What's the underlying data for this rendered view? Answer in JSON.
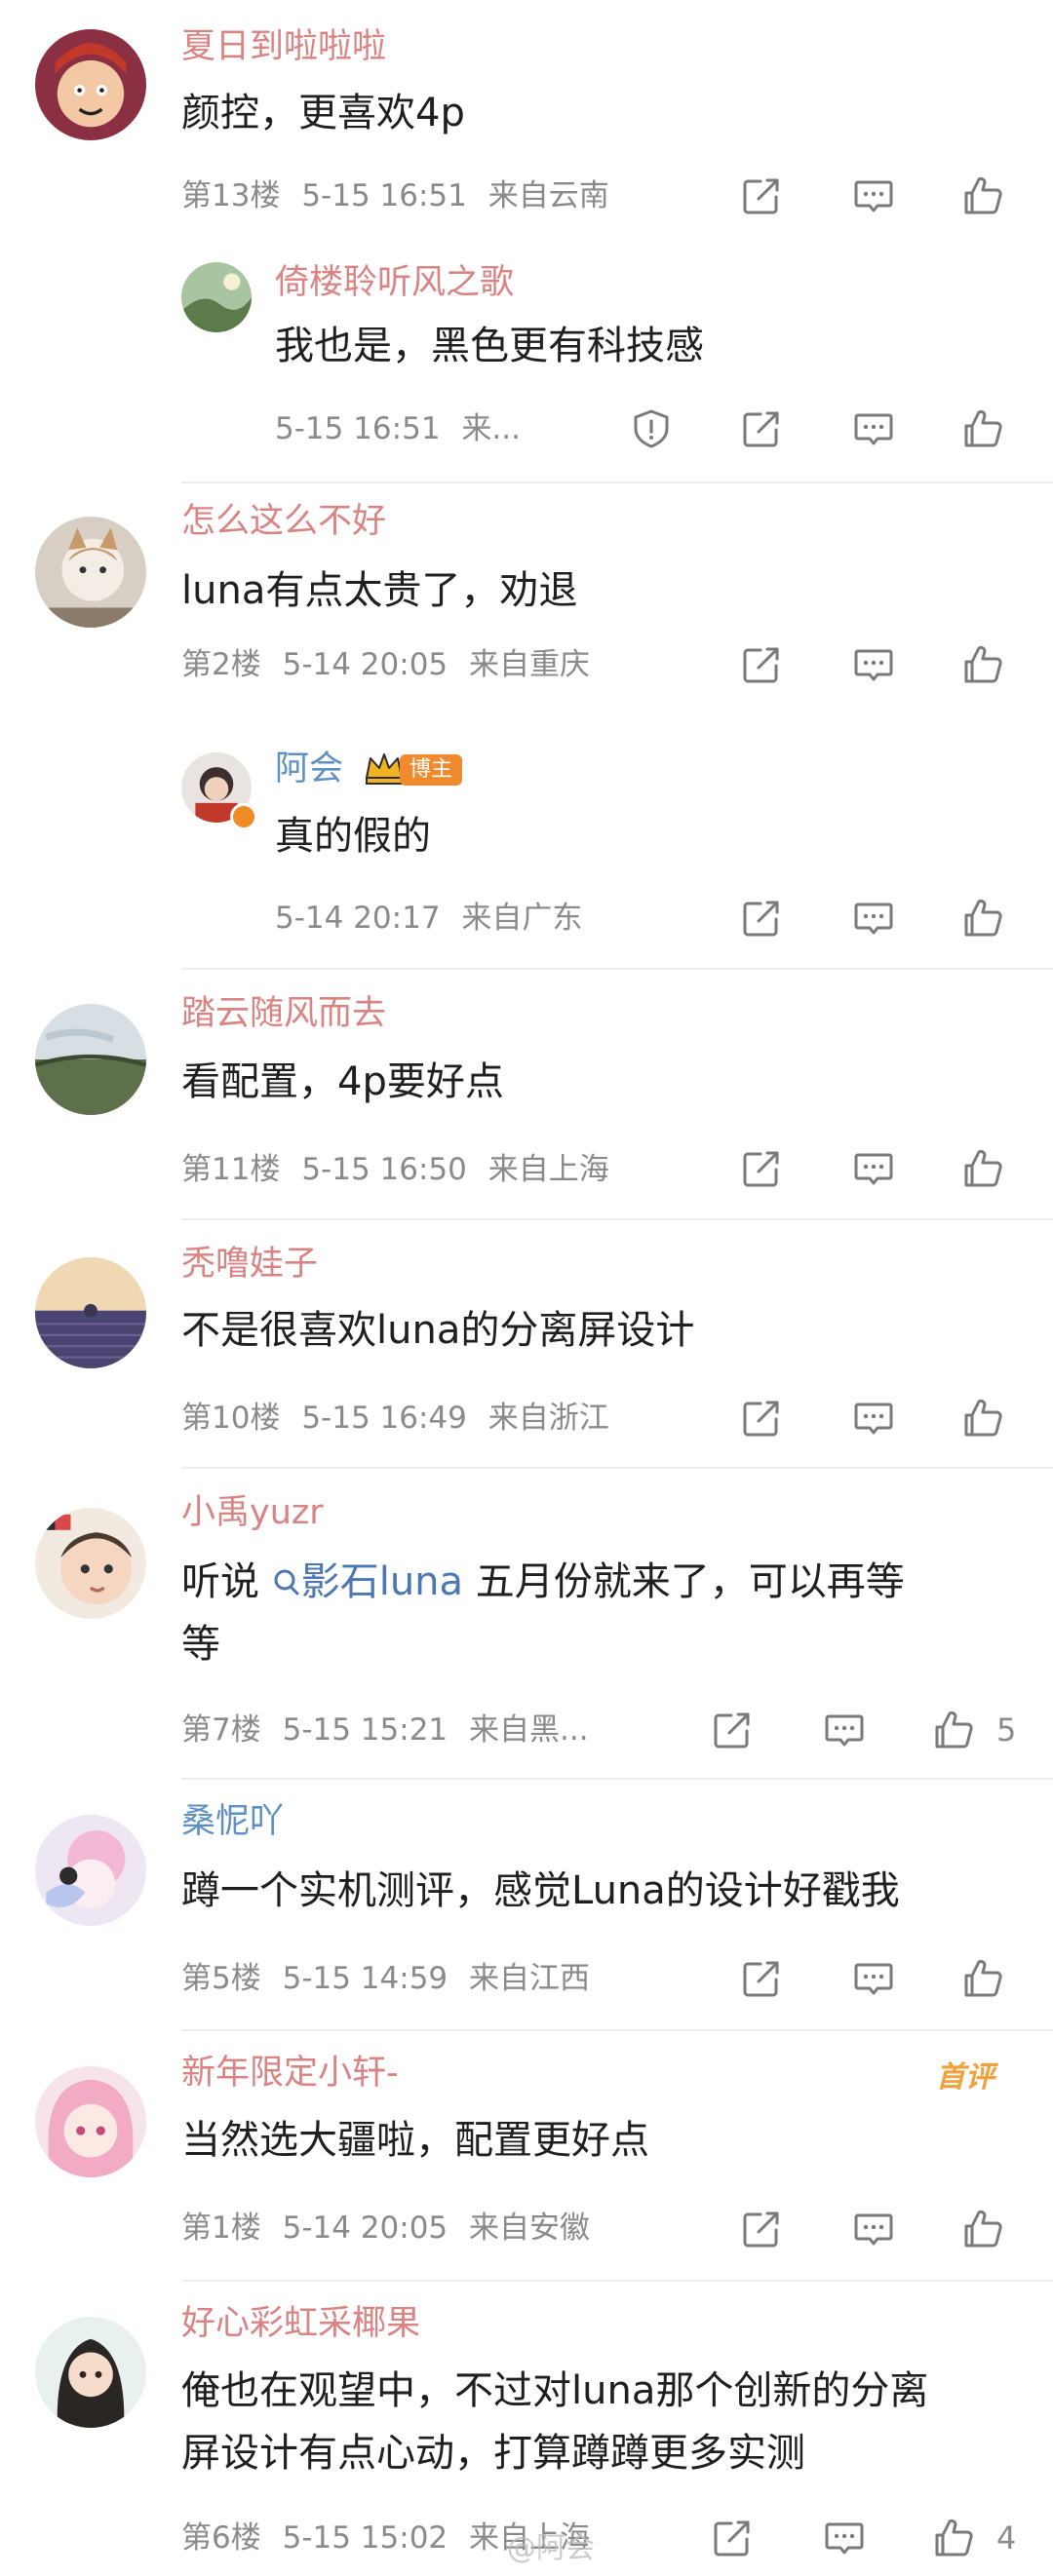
{
  "comments": [
    {
      "user": "夏日到啦啦啦",
      "text": "颜控，更喜欢4p",
      "floor": "第13楼",
      "time": "5-15 16:51",
      "location": "来自云南"
    },
    {
      "user": "倚楼聆听风之歌",
      "text": "我也是，黑色更有科技感",
      "time": "5-15 16:51",
      "location": "来..."
    },
    {
      "user": "怎么这么不好",
      "text": "luna有点太贵了，劝退",
      "floor": "第2楼",
      "time": "5-14 20:05",
      "location": "来自重庆"
    },
    {
      "user": "阿会",
      "badge": "博主",
      "text": "真的假的",
      "time": "5-14 20:17",
      "location": "来自广东"
    },
    {
      "user": "踏云随风而去",
      "text": "看配置，4p要好点",
      "floor": "第11楼",
      "time": "5-15 16:50",
      "location": "来自上海"
    },
    {
      "user": "秃噜娃子",
      "text": "不是很喜欢luna的分离屏设计",
      "floor": "第10楼",
      "time": "5-15 16:49",
      "location": "来自浙江"
    },
    {
      "user": "小禹yuzr",
      "text_before": "听说",
      "topic": "影石luna",
      "text_after": " 五月份就来了，可以再等",
      "text_line2": "等",
      "floor": "第7楼",
      "time": "5-15 15:21",
      "location": "来自黑...",
      "likes": "5"
    },
    {
      "user": "桑怩吖",
      "text": "蹲一个实机测评，感觉Luna的设计好戳我",
      "floor": "第5楼",
      "time": "5-15 14:59",
      "location": "来自江西"
    },
    {
      "user": "新年限定小轩-",
      "tag": "首评",
      "text": "当然选大疆啦，配置更好点",
      "floor": "第1楼",
      "time": "5-14 20:05",
      "location": "来自安徽"
    },
    {
      "user": "好心彩虹采椰果",
      "text_line1": "俺也在观望中，不过对luna那个创新的分离",
      "text_line2": "屏设计有点心动，打算蹲蹲更多实测",
      "floor": "第6楼",
      "time": "5-15 15:02",
      "location": "来自上海",
      "likes": "4"
    }
  ],
  "watermark": "@阿会",
  "colors": {
    "username": "#d98383",
    "username_blogger": "#5e8fc3",
    "meta": "#8a8a8a",
    "badge": "#ef8a2f",
    "topic_link": "#4b78b5"
  },
  "icons": [
    "repost-icon",
    "comment-icon",
    "like-icon",
    "report-icon",
    "search-icon",
    "crown-icon"
  ]
}
